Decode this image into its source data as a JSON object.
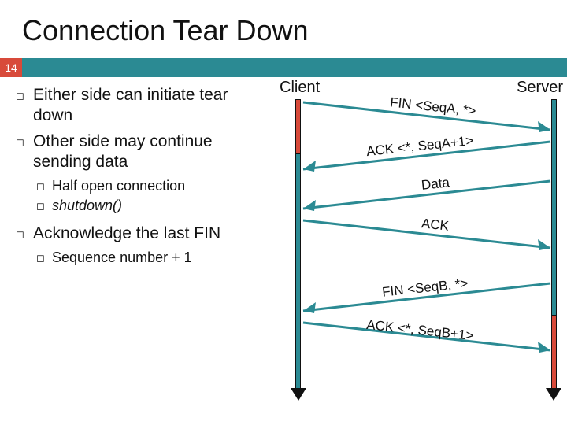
{
  "title": "Connection Tear Down",
  "page_number": "14",
  "bullets": {
    "b1": "Either side can initiate tear down",
    "b2": "Other side may continue sending data",
    "b2a": "Half open connection",
    "b2b": "shutdown()",
    "b3": "Acknowledge the last FIN",
    "b3a": "Sequence number + 1"
  },
  "diagram": {
    "client": "Client",
    "server": "Server",
    "messages": {
      "m1": "FIN <SeqA, *>",
      "m2": "ACK <*, SeqA+1>",
      "m3": "Data",
      "m4": "ACK",
      "m5": "FIN <SeqB, *>",
      "m6": "ACK <*, SeqB+1>"
    }
  }
}
